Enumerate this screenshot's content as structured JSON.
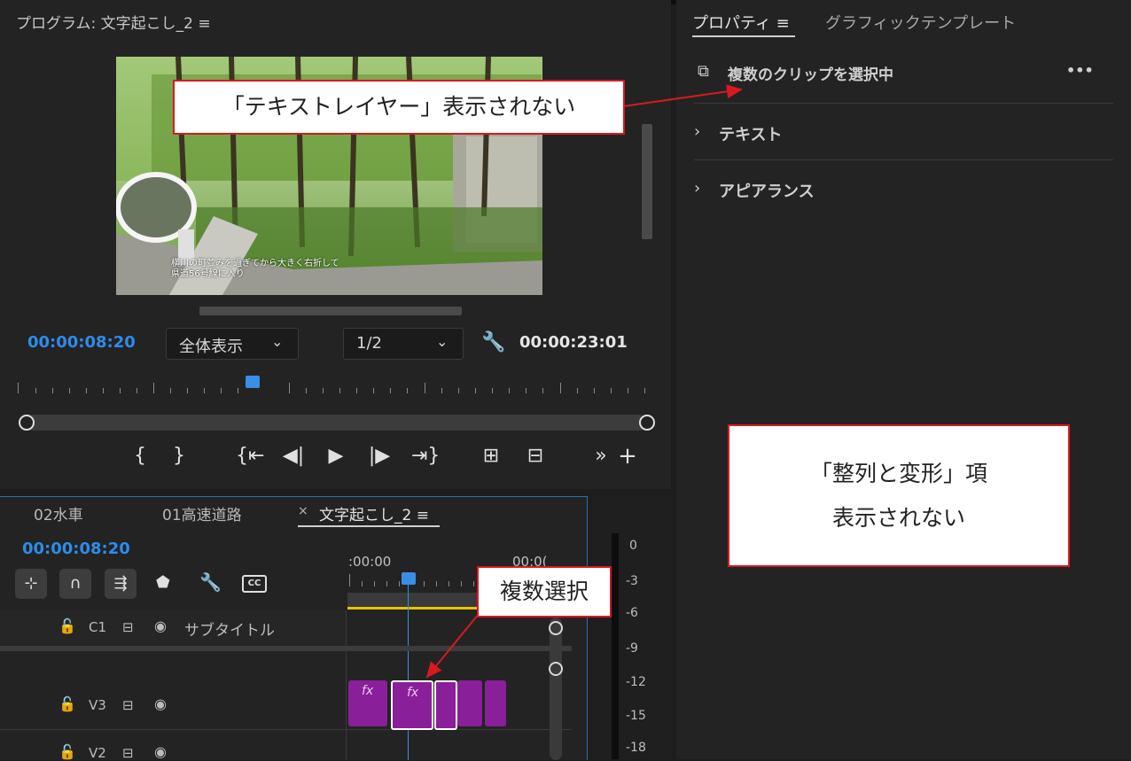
{
  "program": {
    "title": "プログラム: 文字起こし_2 ≡",
    "subtitle_line1": "横川の町並みを過ぎてから大きく右折して",
    "subtitle_line2": "県道56号線に入り",
    "timecode_current": "00:00:08:20",
    "fit_dropdown": "全体表示",
    "resolution_dropdown": "1/2",
    "timecode_duration": "00:00:23:01"
  },
  "properties": {
    "tab_properties": "プロパティ ≡",
    "tab_graphic_templates": "グラフィックテンプレート",
    "selection_label": "複数のクリップを選択中",
    "more_icon": "•••",
    "section_text": "テキスト",
    "section_appearance": "アピアランス"
  },
  "timeline": {
    "tabs": [
      "02水車",
      "01高速道路",
      "文字起こし_2 ≡"
    ],
    "close_mark": "×",
    "timecode": "00:00:08:20",
    "ruler_start": ":00:00",
    "ruler_end": "00:0(",
    "tracks": [
      {
        "name": "C1",
        "label": "サブタイトル"
      },
      {
        "name": "V3",
        "label": ""
      },
      {
        "name": "V2",
        "label": ""
      }
    ],
    "fx_label": "fx"
  },
  "meters": {
    "scale": [
      "0",
      "-3",
      "-6",
      "-9",
      "-12",
      "-15",
      "-18"
    ]
  },
  "annotations": {
    "callout_text_layer": "「テキストレイヤー」表示されない",
    "callout_align_line1": "「整列と変形」項",
    "callout_align_line2": "表示されない",
    "callout_multi_select": "複数選択"
  },
  "colors": {
    "accent_blue": "#2d8ceb",
    "clip_purple": "#8a1f9a",
    "callout_red": "#d71920",
    "work_area_yellow": "#e6c300"
  }
}
